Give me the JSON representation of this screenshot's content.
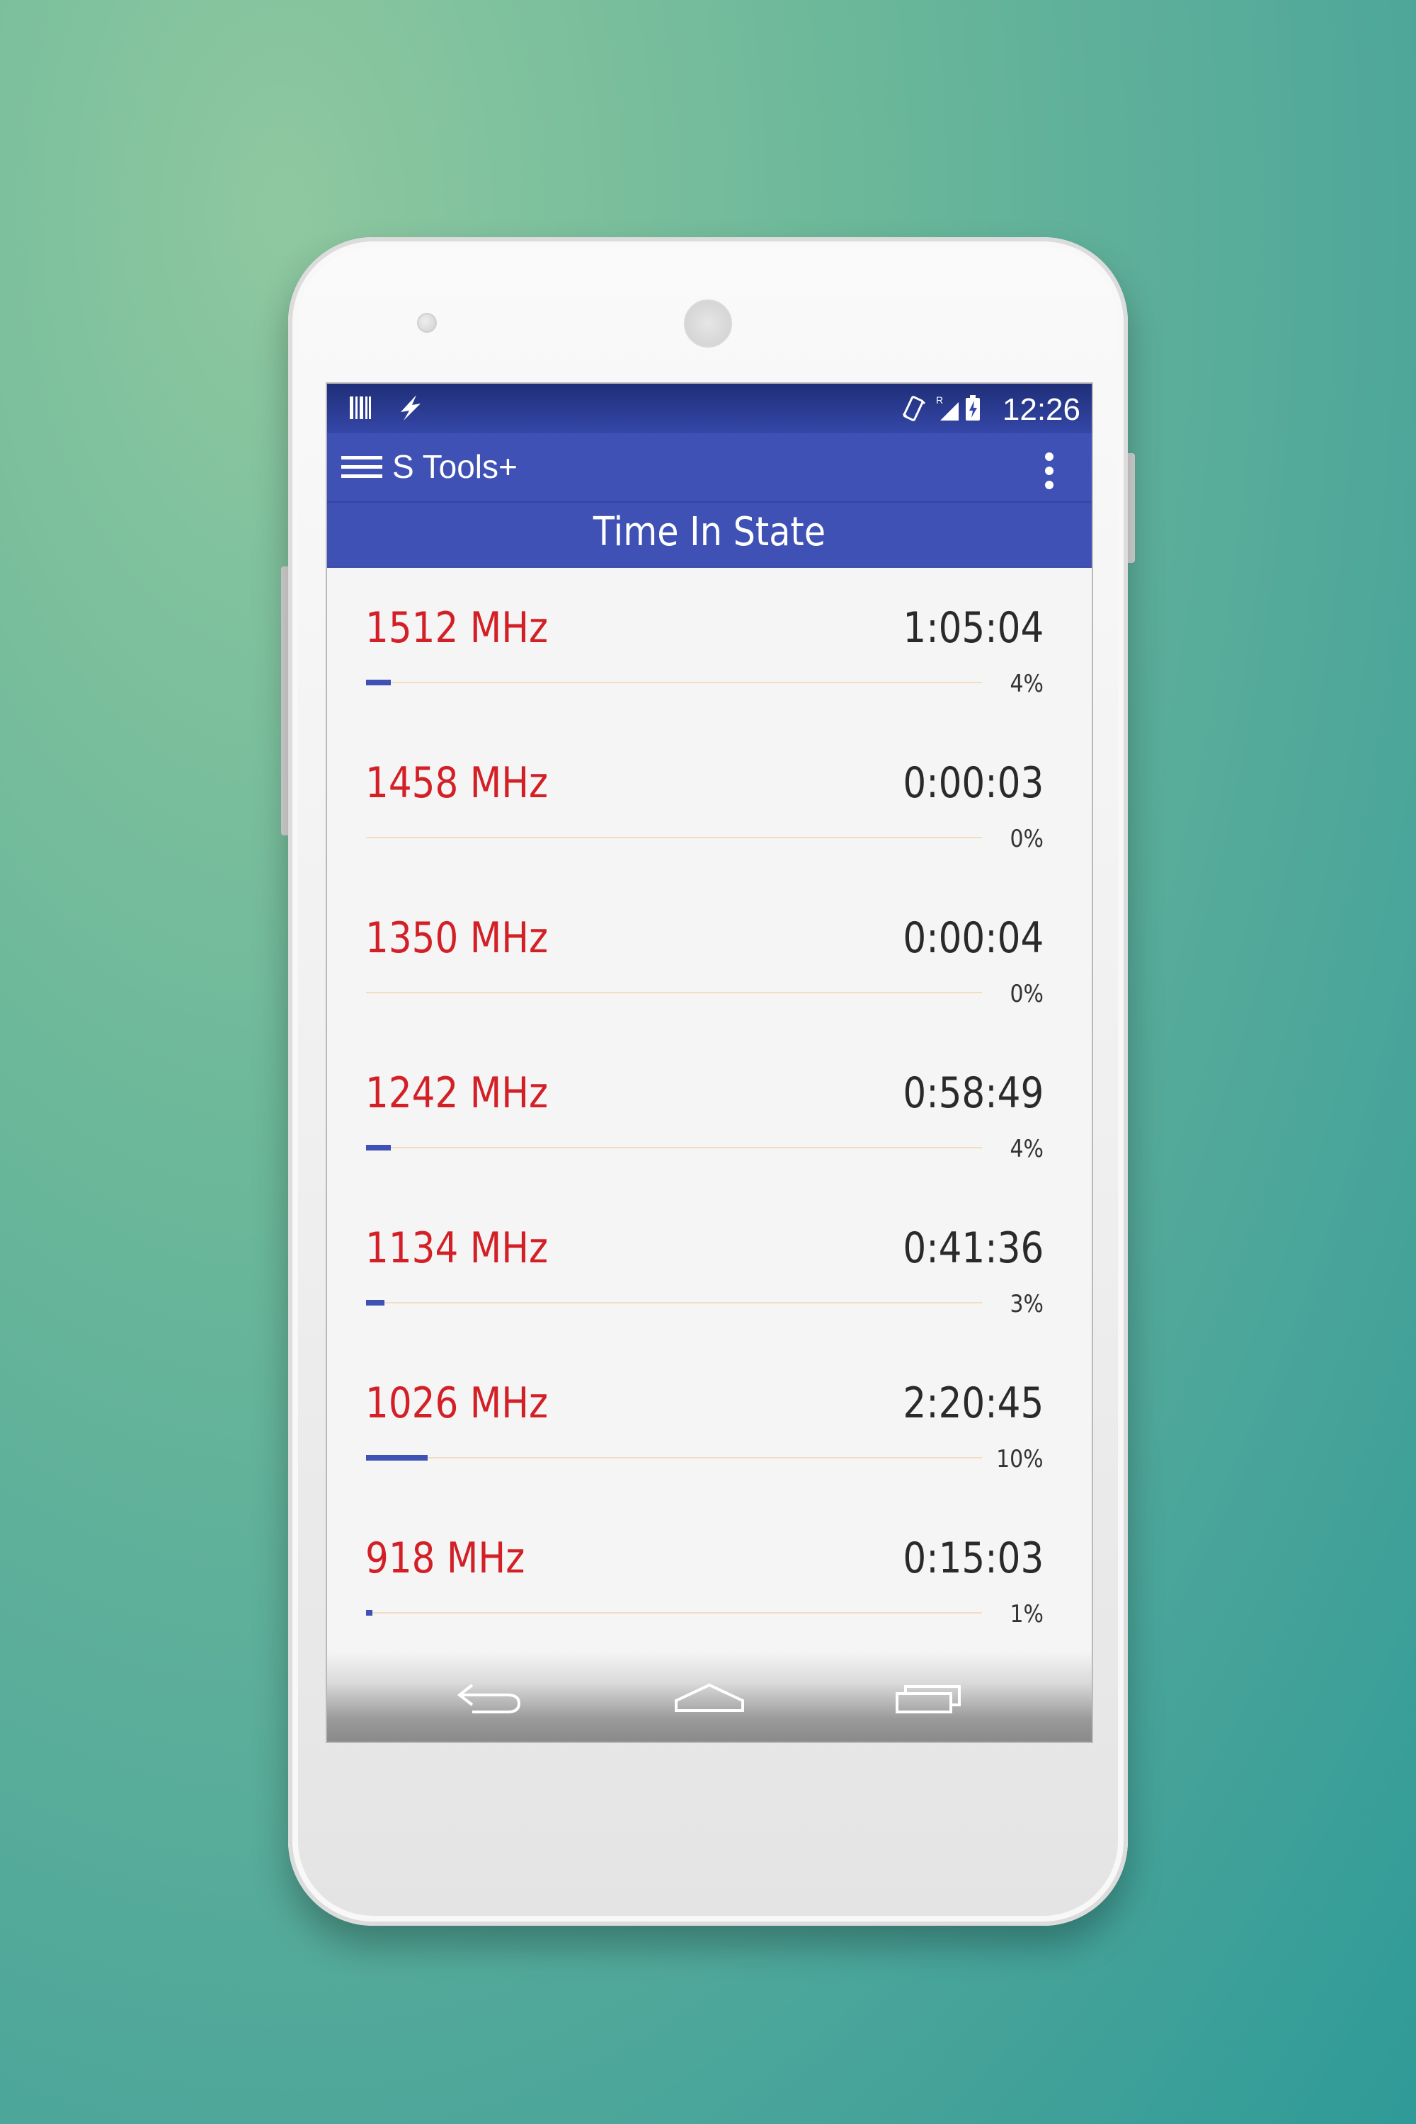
{
  "status_bar": {
    "time": "12:26",
    "left_icons": [
      "barcode-icon",
      "flash-icon"
    ],
    "right_icons": [
      "vibrate-icon",
      "roaming-signal-icon",
      "battery-charging-icon"
    ],
    "roaming_indicator": "R"
  },
  "app_bar": {
    "title": "S Tools+",
    "menu_icon": "hamburger-menu-icon",
    "overflow_icon": "more-vert-icon"
  },
  "section": {
    "title": "Time In State"
  },
  "states": [
    {
      "frequency": "1512 MHz",
      "time": "1:05:04",
      "percent": "4%",
      "fraction": 0.04
    },
    {
      "frequency": "1458 MHz",
      "time": "0:00:03",
      "percent": "0%",
      "fraction": 0.0
    },
    {
      "frequency": "1350 MHz",
      "time": "0:00:04",
      "percent": "0%",
      "fraction": 0.0
    },
    {
      "frequency": "1242 MHz",
      "time": "0:58:49",
      "percent": "4%",
      "fraction": 0.04
    },
    {
      "frequency": "1134 MHz",
      "time": "0:41:36",
      "percent": "3%",
      "fraction": 0.03
    },
    {
      "frequency": "1026 MHz",
      "time": "2:20:45",
      "percent": "10%",
      "fraction": 0.1
    },
    {
      "frequency": "918 MHz",
      "time": "0:15:03",
      "percent": "1%",
      "fraction": 0.01
    }
  ],
  "colors": {
    "primary": "#3f51b5",
    "frequency_text": "#d32027",
    "track": "#f2dcc2"
  },
  "nav_bar": {
    "icons": [
      "back-icon",
      "home-icon",
      "recent-apps-icon"
    ]
  }
}
